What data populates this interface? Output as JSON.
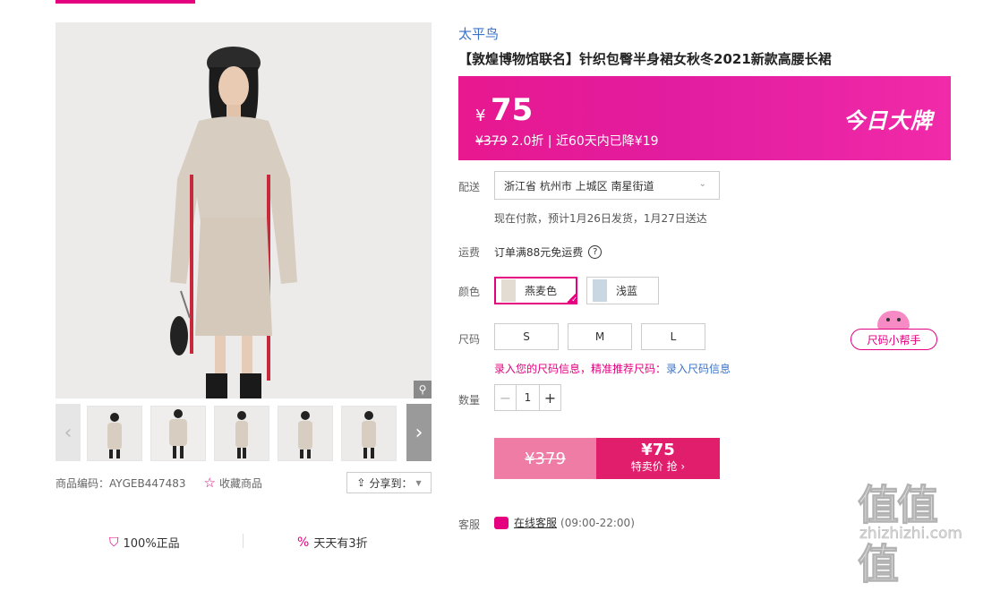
{
  "gallery": {
    "zoom_icon": "magnifier-icon",
    "thumb_count": 5,
    "product_code": "商品编码：AYGEB447483",
    "favorite_label": "收藏商品",
    "share_label": "分享到：",
    "guarantees": [
      "100%正品",
      "天天有3折"
    ]
  },
  "product": {
    "brand": "太平鸟",
    "title": "【敦煌博物馆联名】针织包臀半身裙女秋冬2021新款高腰长裙"
  },
  "price_box": {
    "currency": "¥",
    "price": "75",
    "original": "¥379",
    "discount_text": " 2.0折 | 近60天内已降¥19",
    "badge": "今日大牌",
    "colors": {
      "start": "#e8188f",
      "end": "#f02aa8"
    }
  },
  "delivery": {
    "label": "配送",
    "address": "浙江省 杭州市 上城区 南星街道",
    "note": "现在付款，预计1月26日发货，1月27日送达"
  },
  "freight": {
    "label": "运费",
    "text": "订单满88元免运费",
    "help": "?"
  },
  "color": {
    "label": "颜色",
    "options": [
      {
        "name": "燕麦色",
        "selected": true
      },
      {
        "name": "浅蓝",
        "selected": false
      }
    ]
  },
  "size": {
    "label": "尺码",
    "options": [
      "S",
      "M",
      "L"
    ],
    "tip_text": "录入您的尺码信息，精准推荐尺码：",
    "tip_link": "录入尺码信息",
    "helper": "尺码小帮手"
  },
  "quantity": {
    "label": "数量",
    "value": "1",
    "minus": "−",
    "plus": "+"
  },
  "buy": {
    "old_price": "¥379",
    "price": "¥75",
    "cta": "特卖价 抢 ›"
  },
  "service": {
    "label": "客服",
    "link": "在线客服",
    "hours": "(09:00-22:00)"
  },
  "watermark": {
    "logo": "值值值",
    "url": "zhizhizhi.com"
  },
  "accent_color": "#e4007f"
}
